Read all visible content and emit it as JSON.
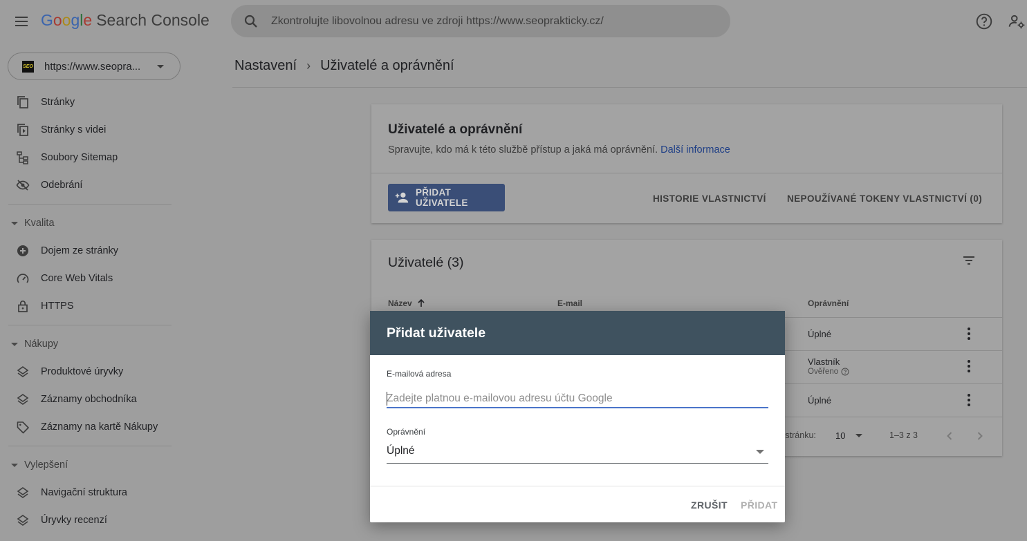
{
  "app": {
    "logo_letters": [
      "G",
      "o",
      "o",
      "g",
      "l",
      "e"
    ],
    "product": "Search Console"
  },
  "search": {
    "placeholder": "Zkontrolujte libovolnou adresu ve zdroji https://www.seoprakticky.cz/"
  },
  "property": {
    "favicon_text": "SEO",
    "url": "https://www.seopra..."
  },
  "sidebar": {
    "top_items": [
      {
        "label": "Stránky",
        "icon": "pages-icon"
      },
      {
        "label": "Stránky s videi",
        "icon": "video-pages-icon"
      },
      {
        "label": "Soubory Sitemap",
        "icon": "sitemap-icon"
      },
      {
        "label": "Odebrání",
        "icon": "removals-icon"
      }
    ],
    "sections": [
      {
        "title": "Kvalita",
        "items": [
          {
            "label": "Dojem ze stránky",
            "icon": "page-experience-icon"
          },
          {
            "label": "Core Web Vitals",
            "icon": "gauge-icon"
          },
          {
            "label": "HTTPS",
            "icon": "lock-icon"
          }
        ]
      },
      {
        "title": "Nákupy",
        "items": [
          {
            "label": "Produktové úryvky",
            "icon": "layers-icon"
          },
          {
            "label": "Záznamy obchodníka",
            "icon": "layers-icon"
          },
          {
            "label": "Záznamy na kartě Nákupy",
            "icon": "tag-icon"
          }
        ]
      },
      {
        "title": "Vylepšení",
        "items": [
          {
            "label": "Navigační struktura",
            "icon": "layers-icon"
          },
          {
            "label": "Úryvky recenzí",
            "icon": "layers-icon"
          }
        ]
      }
    ]
  },
  "breadcrumb": {
    "parent": "Nastavení",
    "separator": "›",
    "current": "Uživatelé a oprávnění"
  },
  "header_card": {
    "title": "Uživatelé a oprávnění",
    "subtitle": "Spravujte, kdo má k této službě přístup a jaká má oprávnění.",
    "link": "Další informace",
    "add_user": "PŘIDAT UŽIVATELE",
    "history": "HISTORIE VLASTNICTVÍ",
    "tokens": "NEPOUŽÍVANÉ TOKENY VLASTNICTVÍ (0)"
  },
  "users_card": {
    "title": "Uživatelé (3)",
    "columns": {
      "name": "Název",
      "email": "E-mail",
      "permission": "Oprávnění"
    },
    "rows": [
      {
        "permission": "Úplné",
        "sub": ""
      },
      {
        "permission": "Vlastník",
        "sub": "Ověřeno"
      },
      {
        "permission": "Úplné",
        "sub": ""
      }
    ],
    "pager": {
      "rows_label": "a stránku:",
      "rows_value": "10",
      "range": "1–3 z 3"
    }
  },
  "dialog": {
    "title": "Přidat uživatele",
    "email_label": "E-mailová adresa",
    "email_placeholder": "Zadejte platnou e-mailovou adresu účtu Google",
    "email_value": "",
    "permission_label": "Oprávnění",
    "permission_value": "Úplné",
    "cancel": "ZRUŠIT",
    "confirm": "PŘIDAT"
  },
  "colors": {
    "primary_button": "#3a4e77",
    "dialog_header": "#3f525f",
    "input_focus": "#4a74c9",
    "link": "#1f3f86"
  }
}
